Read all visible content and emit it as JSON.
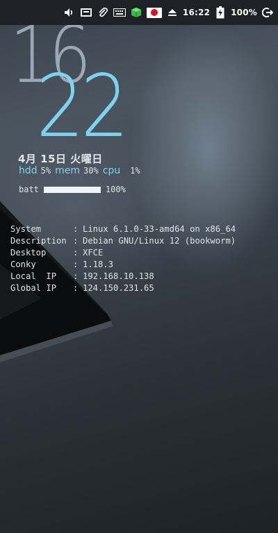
{
  "panel": {
    "icons": [
      "volume-icon",
      "display-icon",
      "paperclip-icon",
      "keyboard-icon",
      "package-icon",
      "japan-flag-icon",
      "eject-icon",
      "battery-charging-icon",
      "logout-icon"
    ],
    "time": "16:22",
    "battery": "100%"
  },
  "conky": {
    "hour": "16",
    "minute": "22",
    "date": "4月 15日 火曜日",
    "stats": {
      "hdd_label": "hdd",
      "hdd_value": "5%",
      "mem_label": "mem",
      "mem_value": "30%",
      "cpu_label": "cpu",
      "cpu_value": "1%"
    },
    "battery": {
      "label": "batt",
      "value": "100%",
      "level": 1.0
    },
    "sysinfo": [
      {
        "key": "System",
        "sep": ":",
        "value": "Linux 6.1.0-33-amd64 on x86_64"
      },
      {
        "key": "Description",
        "sep": ":",
        "value": "Debian GNU/Linux 12 (bookworm)"
      },
      {
        "key": "Desktop",
        "sep": ":",
        "value": "XFCE"
      },
      {
        "key": "Conky",
        "sep": ":",
        "value": "1.18.3"
      },
      {
        "key": "Local  IP",
        "sep": ":",
        "value": "192.168.10.138"
      },
      {
        "key": "Global IP",
        "sep": ":",
        "value": "124.150.231.65"
      }
    ]
  },
  "colors": {
    "accent": "#7fd2ee",
    "panel_bg": "#1e2226",
    "text": "#dfe3e6"
  }
}
